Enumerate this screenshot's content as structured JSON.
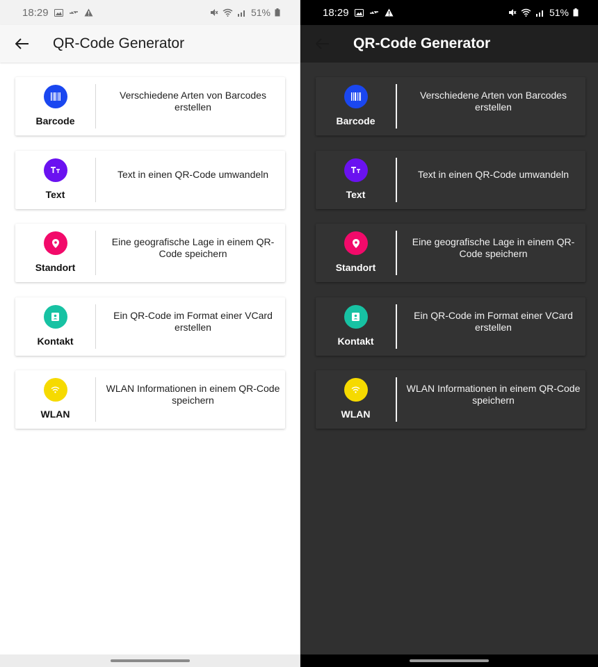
{
  "status": {
    "time": "18:29",
    "battery": "51%"
  },
  "app": {
    "title": "QR-Code Generator"
  },
  "colors": {
    "barcode": "#1a47f0",
    "text": "#6a12f0",
    "standort": "#f20a6a",
    "kontakt": "#17c2a3",
    "wlan": "#f6da00"
  },
  "items": [
    {
      "label": "Barcode",
      "description": "Verschiedene Arten von Barcodes erstellen",
      "icon": "barcode-icon"
    },
    {
      "label": "Text",
      "description": "Text in einen QR-Code umwandeln",
      "icon": "text-format-icon"
    },
    {
      "label": "Standort",
      "description": "Eine geografische Lage in einem QR-Code speichern",
      "icon": "location-pin-icon"
    },
    {
      "label": "Kontakt",
      "description": "Ein QR-Code im Format einer VCard erstellen",
      "icon": "contact-card-icon"
    },
    {
      "label": "WLAN",
      "description": "WLAN Informationen in einem QR-Code speichern",
      "icon": "wifi-icon"
    }
  ]
}
